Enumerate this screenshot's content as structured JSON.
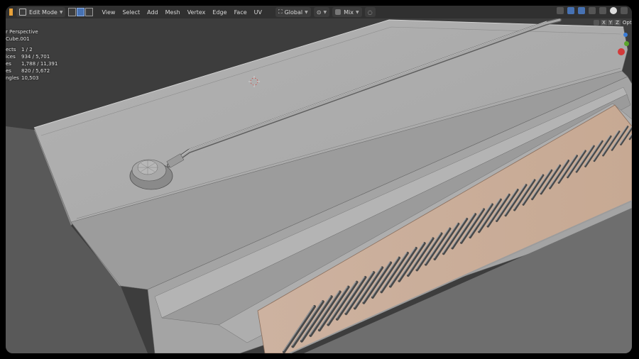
{
  "header": {
    "mode_label": "Edit Mode",
    "menus": [
      "View",
      "Select",
      "Add",
      "Mesh",
      "Vertex",
      "Edge",
      "Face",
      "UV"
    ],
    "transform_orientation": "Global",
    "snap_mode": "Mix",
    "options_label": "Opt"
  },
  "overlay": {
    "view_name": "r Perspective",
    "object_name": "Cube.001",
    "stats": [
      {
        "label": "ects",
        "value": "1 / 2"
      },
      {
        "label": "ices",
        "value": "934 / 5,701"
      },
      {
        "label": "es",
        "value": "1,788 / 11,391"
      },
      {
        "label": "es",
        "value": "820 / 5,672"
      },
      {
        "label": "ngles",
        "value": "10,503"
      }
    ]
  },
  "gizmo": {
    "x_label": "X",
    "y_label": "Y",
    "z_label": "Z"
  },
  "colors": {
    "background": "#3d3d3d",
    "mesh_surface": "#a9a9a9",
    "grille_slat": "#d8b9a4",
    "selection_blue": "#4772b3"
  }
}
